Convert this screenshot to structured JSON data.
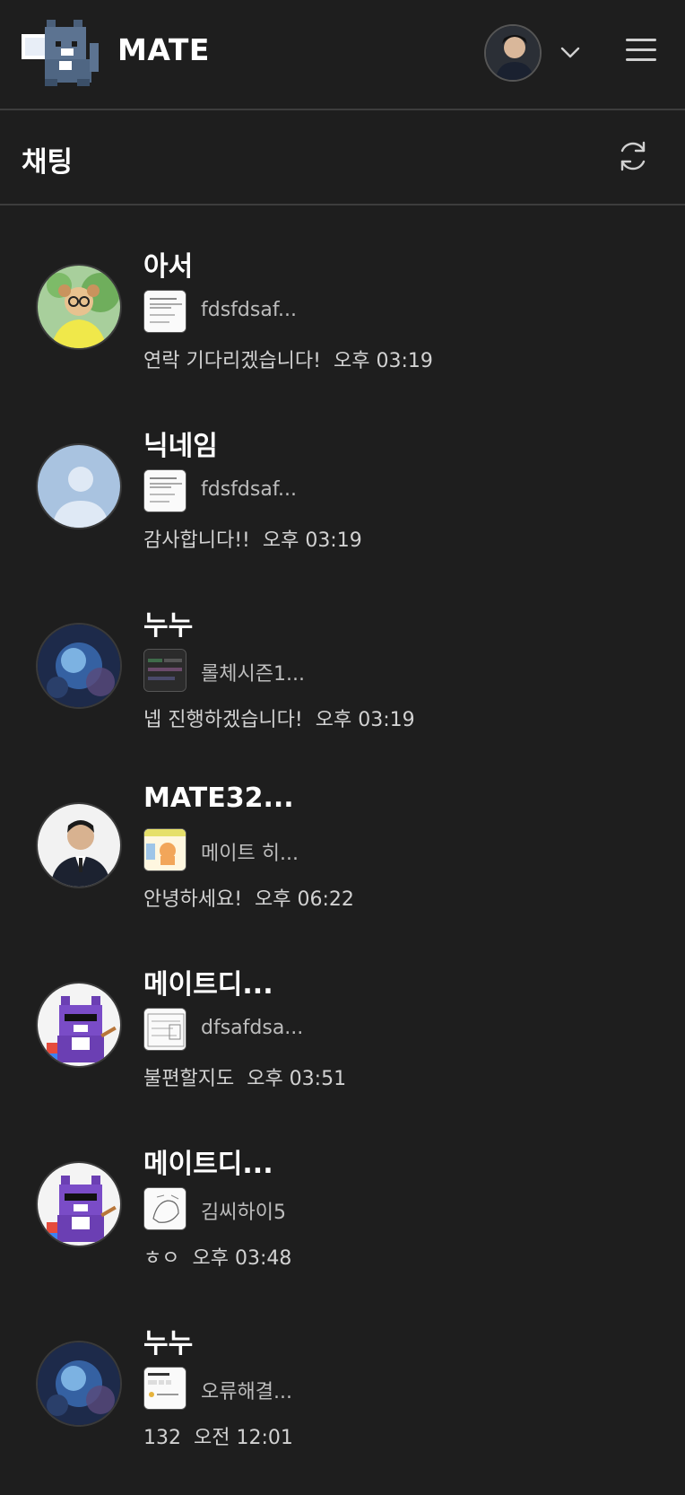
{
  "header": {
    "brand": "MATE",
    "logo_icon": "pixel-cat-logo-icon",
    "user_menu_icon": "chevron-down-icon",
    "menu_icon": "hamburger-menu-icon"
  },
  "subheader": {
    "title": "채팅",
    "refresh_icon": "refresh-icon"
  },
  "colors": {
    "background": "#1e1e1e",
    "divider": "#3d3d3d",
    "text_primary": "#ffffff",
    "text_secondary": "#bdbdbd"
  },
  "chats": [
    {
      "name": "아서",
      "preview": "fdsfdsaf...",
      "last_message": "연락 기다리겠습니다!",
      "time": "오후 03:19",
      "avatar": "arthur-cartoon-avatar",
      "thumb": "document-thumbnail"
    },
    {
      "name": "닉네임",
      "preview": "fdsfdsaf...",
      "last_message": "감사합니다!!",
      "time": "오후 03:19",
      "avatar": "default-user-avatar",
      "thumb": "document-thumbnail"
    },
    {
      "name": "누누",
      "preview": "롤체시즌1...",
      "last_message": "넵 진행하겠습니다!",
      "time": "오후 03:19",
      "avatar": "game-art-avatar",
      "thumb": "dark-screenshot-thumbnail"
    },
    {
      "name": "MATE32...",
      "preview": "메이트 히...",
      "last_message": "안녕하세요!",
      "time": "오후 06:22",
      "avatar": "man-in-suit-avatar",
      "thumb": "cat-mascot-thumbnail"
    },
    {
      "name": "메이트디...",
      "preview": "dfsafdsa...",
      "last_message": "불편할지도",
      "time": "오후 03:51",
      "avatar": "purple-pixel-cat-avatar",
      "thumb": "sketch-thumbnail"
    },
    {
      "name": "메이트디...",
      "preview": "김씨하이5",
      "last_message": "ㅎㅇ",
      "time": "오후 03:48",
      "avatar": "purple-pixel-cat-avatar",
      "thumb": "drawing-thumbnail"
    },
    {
      "name": "누누",
      "preview": "오류해결...",
      "last_message": "132",
      "time": "오전 12:01",
      "avatar": "game-art-avatar",
      "thumb": "form-screenshot-thumbnail"
    }
  ]
}
